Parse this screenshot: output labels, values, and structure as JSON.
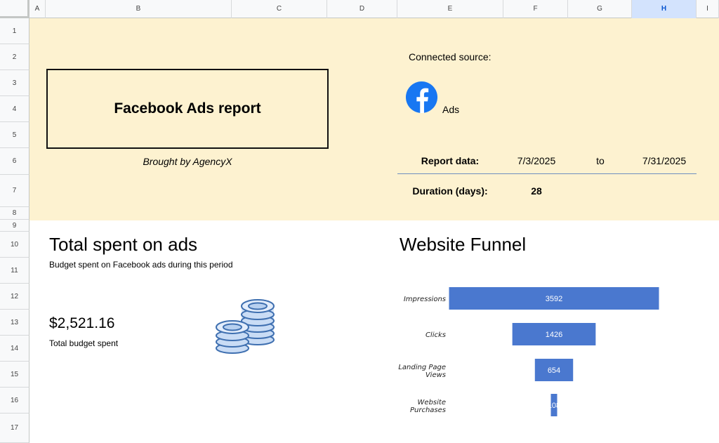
{
  "columns": [
    "A",
    "B",
    "C",
    "D",
    "E",
    "F",
    "G",
    "H",
    "I"
  ],
  "rows": [
    "1",
    "2",
    "3",
    "4",
    "5",
    "6",
    "7",
    "8",
    "9",
    "10",
    "11",
    "12",
    "13",
    "14",
    "15",
    "16",
    "17"
  ],
  "selected_column": "H",
  "colors": {
    "banner": "#fdf2d0",
    "bar": "#4a78cf",
    "facebook": "#1877f2"
  },
  "report": {
    "title": "Facebook Ads report",
    "brought_by": "Brought by AgencyX",
    "connected_label": "Connected source:",
    "source_icon": "facebook-icon",
    "source_name": "Ads",
    "report_data_label": "Report data:",
    "date_from": "7/3/2025",
    "to_word": "to",
    "date_to": "7/31/2025",
    "duration_label": "Duration (days):",
    "duration_value": "28"
  },
  "spent": {
    "title": "Total spent on ads",
    "subtitle": "Budget spent on Facebook ads during this period",
    "amount": "$2,521.16",
    "caption": "Total budget spent",
    "icon": "coins-icon"
  },
  "funnel": {
    "title": "Website Funnel"
  },
  "chart_data": {
    "type": "bar",
    "orientation": "horizontal-centered",
    "categories": [
      [
        "Impressions"
      ],
      [
        "Clicks"
      ],
      [
        "Landing Page",
        "Views"
      ],
      [
        "Website",
        "Purchases"
      ]
    ],
    "values": [
      3592,
      1426,
      654,
      108
    ],
    "data_labels": true
  }
}
